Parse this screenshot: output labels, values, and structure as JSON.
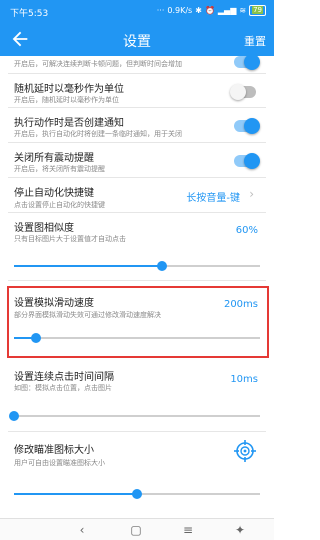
{
  "status_bar": {
    "time": "下午5:53",
    "dots": "···",
    "speed": "0.9K/s",
    "battery": "79"
  },
  "app_bar": {
    "title": "设置",
    "reset_label": "重置"
  },
  "rows": {
    "top_partial": {
      "subtitle": "开启后，可解决连续判断卡顿问题，但判断时间会增加",
      "toggle_on": true
    },
    "random_delay": {
      "title": "随机延时以毫秒作为单位",
      "subtitle": "开启后，随机延时以毫秒作为单位",
      "toggle_on": false
    },
    "create_notification": {
      "title": "执行动作时是否创建通知",
      "subtitle": "开启后，执行自动化时将创建一条临时通知，用于关闭",
      "toggle_on": true
    },
    "vibration": {
      "title": "关闭所有震动提醒",
      "subtitle": "开启后，将关闭所有震动提醒",
      "toggle_on": true
    },
    "stop_shortcut": {
      "title": "停止自动化快捷键",
      "subtitle": "点击设置停止自动化的快捷键",
      "value": "长按音量-键"
    },
    "image_similarity": {
      "title": "设置图相似度",
      "subtitle": "只有目标图片大于设置值才自动点击",
      "value": "60%",
      "slider_fraction": 0.6
    },
    "swipe_speed": {
      "title": "设置模拟滑动速度",
      "subtitle": "部分界面模拟滑动失效可通过修改滑动速度解决",
      "value": "200ms",
      "slider_fraction": 0.09
    },
    "click_interval": {
      "title": "设置连续点击时间间隔",
      "subtitle": "如图：模拟点击位置，点击图片",
      "value": "10ms",
      "slider_fraction": 0.0
    },
    "aim_icon_size": {
      "title": "修改瞄准图标大小",
      "subtitle": "用户可自由设置瞄准图标大小",
      "slider_fraction": 0.5
    }
  },
  "colors": {
    "primary": "#2196F3",
    "highlight_border": "#e53935"
  },
  "icons": {
    "back": "arrow-left-icon",
    "chevron": "chevron-right-icon",
    "crosshair": "crosshair-icon"
  }
}
